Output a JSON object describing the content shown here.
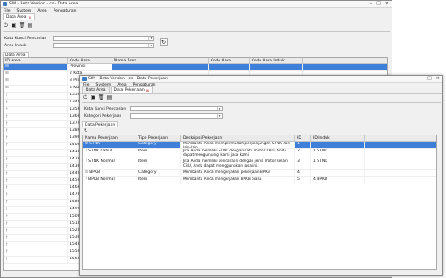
{
  "win1": {
    "title": "SIM - Beta Version - cs - Data Area",
    "menu": [
      "File",
      "System",
      "Area",
      "Pengaturan"
    ],
    "tab_label": "Data Area",
    "form": {
      "kata_kunci_label": "Kata Kunci Pencarian",
      "area_induk_label": "Area Induk"
    },
    "section_label": "Data Area",
    "columns": [
      "ID Area",
      "Kode Area",
      "Nama Area",
      "Kode Area",
      "Kode Area Induk"
    ],
    "rows": [
      {
        "id": "1",
        "kode": "Provinsi",
        "nama": ""
      },
      {
        "id": "",
        "kode": "2 Kota",
        "nama": ""
      },
      {
        "id": "",
        "kode": "3 Provinsi",
        "nama": ""
      },
      {
        "id": "",
        "kode": "4 Kota B",
        "nama": ""
      },
      {
        "id": "",
        "kode": "133 Kecam",
        "nama": ""
      },
      {
        "id": "",
        "kode": "134 Kecam",
        "nama": ""
      },
      {
        "id": "",
        "kode": "135 Kecam",
        "nama": ""
      },
      {
        "id": "",
        "kode": "136 Kecam",
        "nama": ""
      },
      {
        "id": "",
        "kode": "137 Kecam",
        "nama": ""
      },
      {
        "id": "",
        "kode": "138 Kecam",
        "nama": ""
      },
      {
        "id": "",
        "kode": "139 Kecam",
        "nama": ""
      },
      {
        "id": "",
        "kode": "140 Kecam",
        "nama": ""
      },
      {
        "id": "",
        "kode": "141 Kecam",
        "nama": ""
      },
      {
        "id": "",
        "kode": "142 Kecam",
        "nama": ""
      },
      {
        "id": "",
        "kode": "143 Kecam",
        "nama": ""
      },
      {
        "id": "",
        "kode": "144 Kecam",
        "nama": ""
      },
      {
        "id": "",
        "kode": "145 Kecam",
        "nama": ""
      },
      {
        "id": "",
        "kode": "146 Kecam",
        "nama": ""
      },
      {
        "id": "",
        "kode": "147 Kecam",
        "nama": ""
      },
      {
        "id": "",
        "kode": "148 Kecam",
        "nama": ""
      },
      {
        "id": "",
        "kode": "149 Kecam",
        "nama": ""
      },
      {
        "id": "",
        "kode": "150 Kecam",
        "nama": ""
      },
      {
        "id": "",
        "kode": "151 Kecam",
        "nama": ""
      },
      {
        "id": "",
        "kode": "152 Kecam",
        "nama": ""
      },
      {
        "id": "",
        "kode": "153 Kecam",
        "nama": ""
      },
      {
        "id": "",
        "kode": "154 Kecam",
        "nama": ""
      },
      {
        "id": "",
        "kode": "155 Kecam",
        "nama": ""
      },
      {
        "id": "",
        "kode": "156 Kecam",
        "nama": ""
      }
    ]
  },
  "win2": {
    "title": "SIM - Beta Version - cs - Data Pekerjaan",
    "menu": [
      "File",
      "System",
      "Area",
      "Pengaturan"
    ],
    "tabs": [
      {
        "label": "Data Area",
        "active": false
      },
      {
        "label": "Data Pekerjaan",
        "active": true
      }
    ],
    "form": {
      "kata_kunci_label": "Kata Kunci Pencarian",
      "kategori_label": "Kategori Pekerjaan"
    },
    "section_label": "Data Pekerjaan",
    "columns": [
      "Nama Pekerjaan",
      "Tipe Pekerjaan",
      "Deskripsi Pekerjaan",
      "ID",
      "ID Induk"
    ],
    "rows": [
      {
        "indent": 0,
        "nama": "STNK",
        "tipe": "Category",
        "desk": "Membantu Anda mempermudah perpanjangan STNK dan lain-lain",
        "id": "1",
        "induk": "",
        "selected": true
      },
      {
        "indent": 1,
        "nama": "STNK Cabut",
        "tipe": "Item",
        "desk": "Jika Anda memiliki STNK dengan satu motor CBU, Anda dapat mengunjungi kami jasa kami",
        "id": "2",
        "induk": "1 STNK"
      },
      {
        "indent": 1,
        "nama": "STNK Normal",
        "tipe": "Item",
        "desk": "Jika Anda memiliki kendaraan dengan jenis motor selain CBU, Anda dapat menggunakan jasa ini.",
        "id": "3",
        "induk": "1 STNK"
      },
      {
        "indent": 0,
        "nama": "BPKB",
        "tipe": "Category",
        "desk": "Membantu Anda mengerjakan pekerjaan BPKB",
        "id": "4",
        "induk": ""
      },
      {
        "indent": 1,
        "nama": "BPKB Normal",
        "tipe": "Item",
        "desk": "Membantu Anda mengerjakan BPKB biasa",
        "id": "5",
        "induk": "4 BPKB"
      }
    ]
  },
  "icons": {
    "toolbar": [
      "power-icon",
      "save-icon",
      "delete-icon",
      "print-icon"
    ],
    "refresh": "refresh-icon"
  },
  "colors": {
    "selection": "#3d7fd9",
    "close_tab": "#c0392b"
  }
}
